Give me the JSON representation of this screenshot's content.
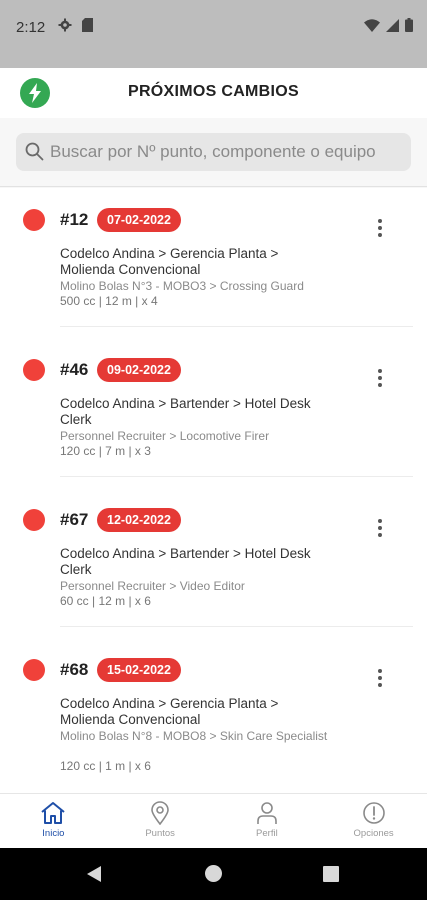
{
  "status_bar": {
    "time": "2:12"
  },
  "header": {
    "title": "PRÓXIMOS CAMBIOS"
  },
  "search": {
    "placeholder": "Buscar por Nº punto, componente o equipo"
  },
  "items": [
    {
      "number": "#12",
      "date": "07-02-2022",
      "path": "Codelco Andina > Gerencia Planta > Molienda Convencional",
      "detail": "Molino Bolas N°3 - MOBO3 > Crossing Guard",
      "spec": "500 cc | 12 m | x 4"
    },
    {
      "number": "#46",
      "date": "09-02-2022",
      "path": "Codelco Andina > Bartender > Hotel Desk Clerk",
      "detail": "Personnel Recruiter > Locomotive Firer",
      "spec": "120 cc | 7 m | x 3"
    },
    {
      "number": "#67",
      "date": "12-02-2022",
      "path": "Codelco Andina > Bartender > Hotel Desk Clerk",
      "detail": "Personnel Recruiter > Video Editor",
      "spec": "60 cc | 12 m | x 6"
    },
    {
      "number": "#68",
      "date": "15-02-2022",
      "path": "Codelco Andina > Gerencia Planta > Molienda Convencional",
      "detail": "Molino Bolas N°8 - MOBO8 > Skin Care Specialist",
      "spec": "120 cc | 1 m | x 6"
    }
  ],
  "bottom_nav": [
    {
      "label": "Inicio",
      "icon": "home-icon",
      "active": true
    },
    {
      "label": "Puntos",
      "icon": "location-pin-icon",
      "active": false
    },
    {
      "label": "Perfil",
      "icon": "person-icon",
      "active": false
    },
    {
      "label": "Opciones",
      "icon": "info-circle-icon",
      "active": false
    }
  ],
  "colors": {
    "status_dot": "#f0413a",
    "date_badge": "#e53935",
    "logo": "#34a853",
    "nav_active": "#1f4fa8"
  }
}
